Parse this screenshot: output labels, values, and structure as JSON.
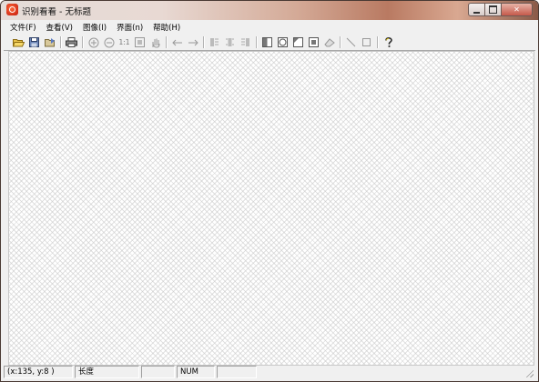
{
  "window": {
    "title": "识别看看 - 无标题",
    "app_icon": "recognize-app-icon",
    "caption_buttons": [
      "minimize-icon",
      "maximize-icon",
      "close-icon"
    ],
    "close_glyph": "✕"
  },
  "menubar": {
    "items": [
      "文件(F)",
      "查看(V)",
      "图像(I)",
      "界面(n)",
      "帮助(H)"
    ]
  },
  "toolbar": {
    "zoom_actual_label": "1:1",
    "icons": [
      "open-folder-icon",
      "save-icon",
      "save-as-icon",
      "print-icon",
      "zoom-in-icon",
      "zoom-out-icon",
      "actual-size-icon",
      "fit-window-icon",
      "hand-pan-icon",
      "previous-arrow-icon",
      "next-arrow-icon",
      "align-left-icon",
      "align-center-icon",
      "align-right-icon",
      "select-half-icon",
      "select-ellipse-icon",
      "select-corner-icon",
      "select-rect-icon",
      "eraser-icon",
      "line-tool-icon",
      "rectangle-tool-icon",
      "help-icon"
    ]
  },
  "statusbar": {
    "coords": "(x:135, y:8 )",
    "length_label": "长度",
    "empty_cell": "",
    "num_label": "NUM",
    "empty_cell_2": ""
  }
}
